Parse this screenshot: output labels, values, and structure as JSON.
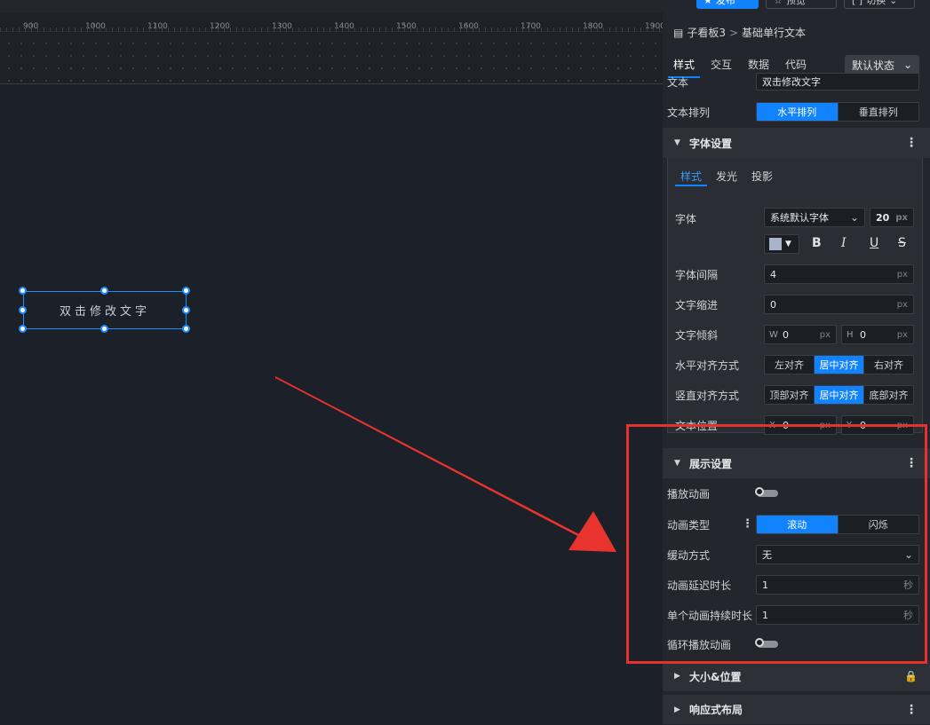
{
  "topbar": {
    "publish_label": "发布",
    "preview_label": "预览",
    "switch_label": "切换"
  },
  "ruler": {
    "labels": [
      "900",
      "1000",
      "1100",
      "1200",
      "1300",
      "1400",
      "1500",
      "1600",
      "1700",
      "1800",
      "1900"
    ]
  },
  "canvas": {
    "widget_text": "双击修改文字"
  },
  "panel": {
    "breadcrumb": {
      "parent": "子看板3",
      "separator": ">",
      "current": "基础单行文本"
    },
    "tabs": [
      {
        "label": "样式",
        "active": true
      },
      {
        "label": "交互",
        "active": false
      },
      {
        "label": "数据",
        "active": false
      },
      {
        "label": "代码",
        "active": false
      }
    ],
    "state_select": "默认状态",
    "text_row": {
      "label": "文本",
      "value": "双击修改文字"
    },
    "text_layout": {
      "label": "文本排列",
      "options": [
        "水平排列",
        "垂直排列"
      ],
      "selected": "水平排列"
    },
    "font_section": {
      "title": "字体设置",
      "subtabs": [
        "样式",
        "发光",
        "投影"
      ],
      "font": {
        "label": "字体",
        "value": "系统默认字体",
        "size": "20",
        "unit": "px"
      },
      "color_swatch": "#a9b4cc",
      "format_buttons": [
        "B",
        "I",
        "U",
        "S"
      ],
      "letter_spacing": {
        "label": "字体间隔",
        "value": "4",
        "unit": "px"
      },
      "indent": {
        "label": "文字缩进",
        "value": "0",
        "unit": "px"
      },
      "skew": {
        "label": "文字倾斜",
        "w_label": "W",
        "w_value": "0",
        "h_label": "H",
        "h_value": "0",
        "unit": "px"
      },
      "h_align": {
        "label": "水平对齐方式",
        "options": [
          "左对齐",
          "居中对齐",
          "右对齐"
        ],
        "selected": "居中对齐"
      },
      "v_align": {
        "label": "竖直对齐方式",
        "options": [
          "顶部对齐",
          "居中对齐",
          "底部对齐"
        ],
        "selected": "居中对齐"
      },
      "position": {
        "label": "文本位置",
        "x_label": "X",
        "x_value": "0",
        "y_label": "Y",
        "y_value": "0",
        "unit": "px"
      }
    },
    "display_section": {
      "title": "展示设置",
      "play_animation": {
        "label": "播放动画"
      },
      "animation_type": {
        "label": "动画类型",
        "options": [
          "滚动",
          "闪烁"
        ],
        "selected": "滚动"
      },
      "easing": {
        "label": "缓动方式",
        "value": "无"
      },
      "delay": {
        "label": "动画延迟时长",
        "value": "1",
        "unit": "秒"
      },
      "duration": {
        "label": "单个动画持续时长",
        "value": "1",
        "unit": "秒"
      },
      "loop": {
        "label": "循环播放动画"
      }
    },
    "size_section": {
      "title": "大小&位置"
    },
    "responsive_section": {
      "title": "响应式布局"
    }
  },
  "colors": {
    "accent": "#1283ff",
    "annotation_red": "#e5322d"
  }
}
